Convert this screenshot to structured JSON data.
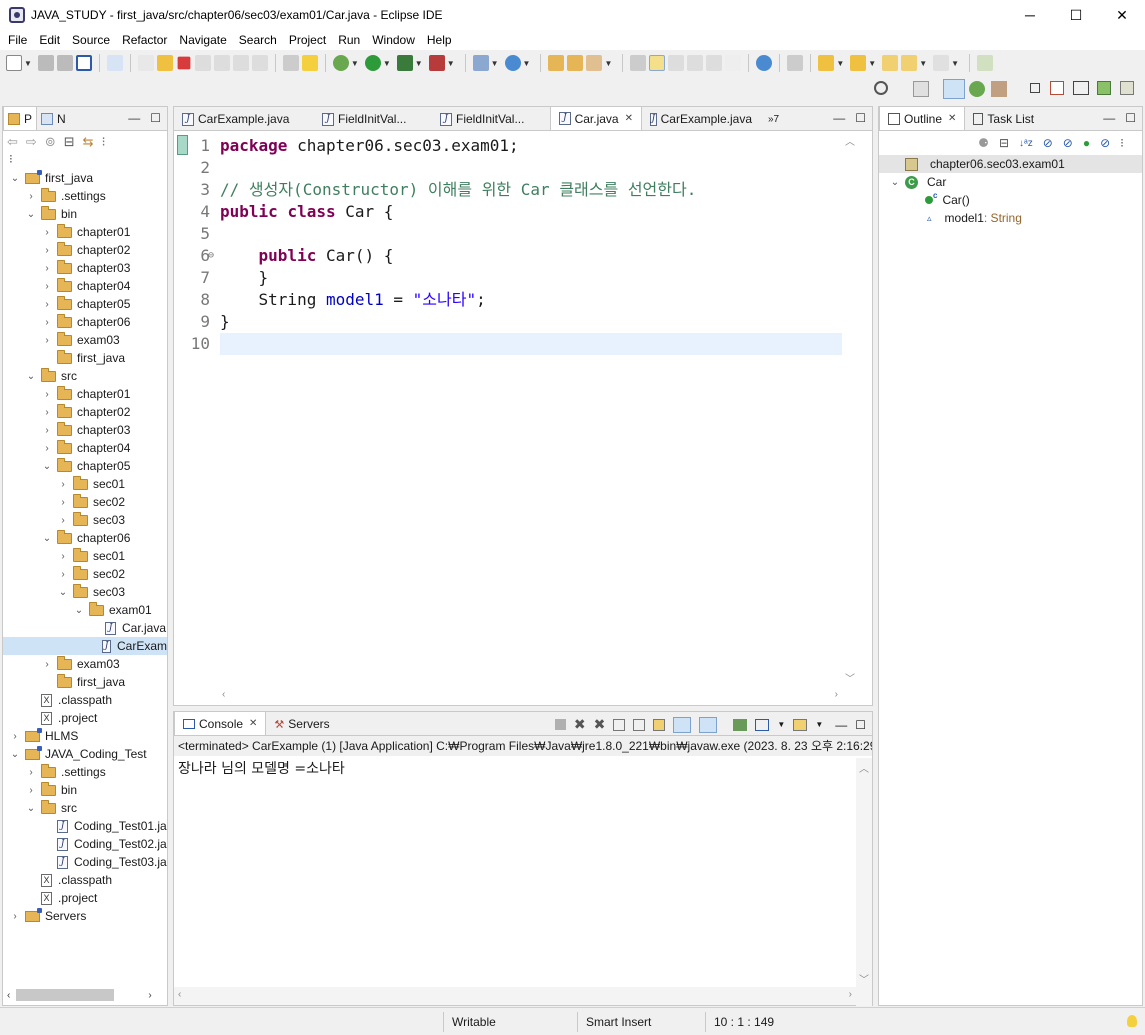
{
  "window": {
    "title": "JAVA_STUDY - first_java/src/chapter06/sec03/exam01/Car.java - Eclipse IDE",
    "minimize": "─",
    "maximize": "☐",
    "close": "✕"
  },
  "menu": [
    "File",
    "Edit",
    "Source",
    "Refactor",
    "Navigate",
    "Search",
    "Project",
    "Run",
    "Window",
    "Help"
  ],
  "explorer": {
    "tabs": [
      {
        "label": "P"
      },
      {
        "label": "N"
      }
    ],
    "tree": [
      {
        "indent": 0,
        "chev": "⌄",
        "icon": "proj",
        "label": "first_java"
      },
      {
        "indent": 1,
        "chev": "›",
        "icon": "folder",
        "label": ".settings"
      },
      {
        "indent": 1,
        "chev": "⌄",
        "icon": "folder",
        "label": "bin"
      },
      {
        "indent": 2,
        "chev": "›",
        "icon": "folder",
        "label": "chapter01"
      },
      {
        "indent": 2,
        "chev": "›",
        "icon": "folder",
        "label": "chapter02"
      },
      {
        "indent": 2,
        "chev": "›",
        "icon": "folder",
        "label": "chapter03"
      },
      {
        "indent": 2,
        "chev": "›",
        "icon": "folder",
        "label": "chapter04"
      },
      {
        "indent": 2,
        "chev": "›",
        "icon": "folder",
        "label": "chapter05"
      },
      {
        "indent": 2,
        "chev": "›",
        "icon": "folder",
        "label": "chapter06"
      },
      {
        "indent": 2,
        "chev": "›",
        "icon": "folder",
        "label": "exam03"
      },
      {
        "indent": 2,
        "chev": "",
        "icon": "folder",
        "label": "first_java"
      },
      {
        "indent": 1,
        "chev": "⌄",
        "icon": "folder",
        "label": "src"
      },
      {
        "indent": 2,
        "chev": "›",
        "icon": "folder",
        "label": "chapter01"
      },
      {
        "indent": 2,
        "chev": "›",
        "icon": "folder",
        "label": "chapter02"
      },
      {
        "indent": 2,
        "chev": "›",
        "icon": "folder",
        "label": "chapter03"
      },
      {
        "indent": 2,
        "chev": "›",
        "icon": "folder",
        "label": "chapter04"
      },
      {
        "indent": 2,
        "chev": "⌄",
        "icon": "folder",
        "label": "chapter05"
      },
      {
        "indent": 3,
        "chev": "›",
        "icon": "folder",
        "label": "sec01"
      },
      {
        "indent": 3,
        "chev": "›",
        "icon": "folder",
        "label": "sec02"
      },
      {
        "indent": 3,
        "chev": "›",
        "icon": "folder",
        "label": "sec03"
      },
      {
        "indent": 2,
        "chev": "⌄",
        "icon": "folder",
        "label": "chapter06"
      },
      {
        "indent": 3,
        "chev": "›",
        "icon": "folder",
        "label": "sec01"
      },
      {
        "indent": 3,
        "chev": "›",
        "icon": "folder",
        "label": "sec02"
      },
      {
        "indent": 3,
        "chev": "⌄",
        "icon": "folder",
        "label": "sec03"
      },
      {
        "indent": 4,
        "chev": "⌄",
        "icon": "folder",
        "label": "exam01"
      },
      {
        "indent": 5,
        "chev": "",
        "icon": "java",
        "label": "Car.java"
      },
      {
        "indent": 5,
        "chev": "",
        "icon": "java",
        "label": "CarExam",
        "selected": true
      },
      {
        "indent": 2,
        "chev": "›",
        "icon": "folder",
        "label": "exam03"
      },
      {
        "indent": 2,
        "chev": "",
        "icon": "folder",
        "label": "first_java"
      },
      {
        "indent": 1,
        "chev": "",
        "icon": "xml",
        "label": ".classpath"
      },
      {
        "indent": 1,
        "chev": "",
        "icon": "xml",
        "label": ".project"
      },
      {
        "indent": 0,
        "chev": "›",
        "icon": "proj",
        "label": "HLMS"
      },
      {
        "indent": 0,
        "chev": "⌄",
        "icon": "proj",
        "label": "JAVA_Coding_Test"
      },
      {
        "indent": 1,
        "chev": "›",
        "icon": "folder",
        "label": ".settings"
      },
      {
        "indent": 1,
        "chev": "›",
        "icon": "folder",
        "label": "bin"
      },
      {
        "indent": 1,
        "chev": "⌄",
        "icon": "folder",
        "label": "src"
      },
      {
        "indent": 2,
        "chev": "",
        "icon": "java",
        "label": "Coding_Test01.ja"
      },
      {
        "indent": 2,
        "chev": "",
        "icon": "java",
        "label": "Coding_Test02.ja"
      },
      {
        "indent": 2,
        "chev": "",
        "icon": "java",
        "label": "Coding_Test03.ja"
      },
      {
        "indent": 1,
        "chev": "",
        "icon": "xml",
        "label": ".classpath"
      },
      {
        "indent": 1,
        "chev": "",
        "icon": "xml",
        "label": ".project"
      },
      {
        "indent": 0,
        "chev": "›",
        "icon": "proj",
        "label": "Servers"
      }
    ]
  },
  "editor": {
    "tabs": [
      {
        "label": "CarExample.java",
        "active": false
      },
      {
        "label": "FieldInitVal...",
        "active": false
      },
      {
        "label": "FieldInitVal...",
        "active": false
      },
      {
        "label": "Car.java",
        "active": true
      },
      {
        "label": "CarExample.java",
        "active": false
      }
    ],
    "overflow": "»7",
    "lines": [
      {
        "n": "1",
        "parts": [
          {
            "c": "kw",
            "t": "package"
          },
          {
            "c": "",
            "t": " chapter06.sec03.exam01;"
          }
        ]
      },
      {
        "n": "2",
        "parts": []
      },
      {
        "n": "3",
        "parts": [
          {
            "c": "cmt",
            "t": "// 생성자(Constructor) 이해를 위한 Car 클래스를 선언한다."
          }
        ]
      },
      {
        "n": "4",
        "parts": [
          {
            "c": "kw",
            "t": "public"
          },
          {
            "c": "",
            "t": " "
          },
          {
            "c": "kw",
            "t": "class"
          },
          {
            "c": "",
            "t": " Car {"
          }
        ]
      },
      {
        "n": "5",
        "parts": []
      },
      {
        "n": "6",
        "fold": "⊖",
        "parts": [
          {
            "c": "",
            "t": "    "
          },
          {
            "c": "kw",
            "t": "public"
          },
          {
            "c": "",
            "t": " Car() {"
          }
        ]
      },
      {
        "n": "7",
        "parts": [
          {
            "c": "",
            "t": "    }"
          }
        ]
      },
      {
        "n": "8",
        "parts": [
          {
            "c": "",
            "t": "    String "
          },
          {
            "c": "fld",
            "t": "model1"
          },
          {
            "c": "",
            "t": " = "
          },
          {
            "c": "str",
            "t": "\"소나타\""
          },
          {
            "c": "",
            "t": ";"
          }
        ]
      },
      {
        "n": "9",
        "parts": [
          {
            "c": "",
            "t": "}"
          }
        ]
      },
      {
        "n": "10",
        "parts": [],
        "current": true
      }
    ]
  },
  "console": {
    "tabs": [
      {
        "label": "Console"
      },
      {
        "label": "Servers"
      }
    ],
    "status": "<terminated> CarExample (1) [Java Application] C:₩Program Files₩Java₩jre1.8.0_221₩bin₩javaw.exe  (2023. 8. 23 오후 2:16:29",
    "output": "장나라 님의 모델명 =소나타"
  },
  "outline": {
    "tabs": [
      {
        "label": "Outline"
      },
      {
        "label": "Task List"
      }
    ],
    "package": "chapter06.sec03.exam01",
    "class": "Car",
    "constructor": "Car()",
    "constructor_mark": "c",
    "field": "model1",
    "field_type": " : String"
  },
  "status": {
    "writable": "Writable",
    "insert": "Smart Insert",
    "position": "10 : 1 : 149"
  },
  "colors": {
    "keyword": "#7f0055",
    "comment": "#3f7f5f",
    "field": "#0000c0",
    "string": "#2a00ff",
    "current_line": "#e8f2fe"
  }
}
